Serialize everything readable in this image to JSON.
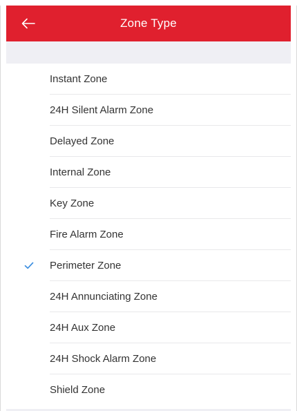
{
  "colors": {
    "header_bg": "#e0202e",
    "header_text": "#ffffff",
    "check_color": "#3d8fe0"
  },
  "header": {
    "title": "Zone Type",
    "back_icon": "arrow-left-icon"
  },
  "zone_types": {
    "selected_index": 6,
    "items": [
      {
        "label": "Instant Zone"
      },
      {
        "label": "24H Silent Alarm Zone"
      },
      {
        "label": "Delayed Zone"
      },
      {
        "label": "Internal Zone"
      },
      {
        "label": "Key Zone"
      },
      {
        "label": "Fire Alarm Zone"
      },
      {
        "label": "Perimeter Zone"
      },
      {
        "label": "24H Annunciating Zone"
      },
      {
        "label": "24H Aux Zone"
      },
      {
        "label": "24H Shock Alarm Zone"
      },
      {
        "label": "Shield Zone"
      }
    ]
  }
}
